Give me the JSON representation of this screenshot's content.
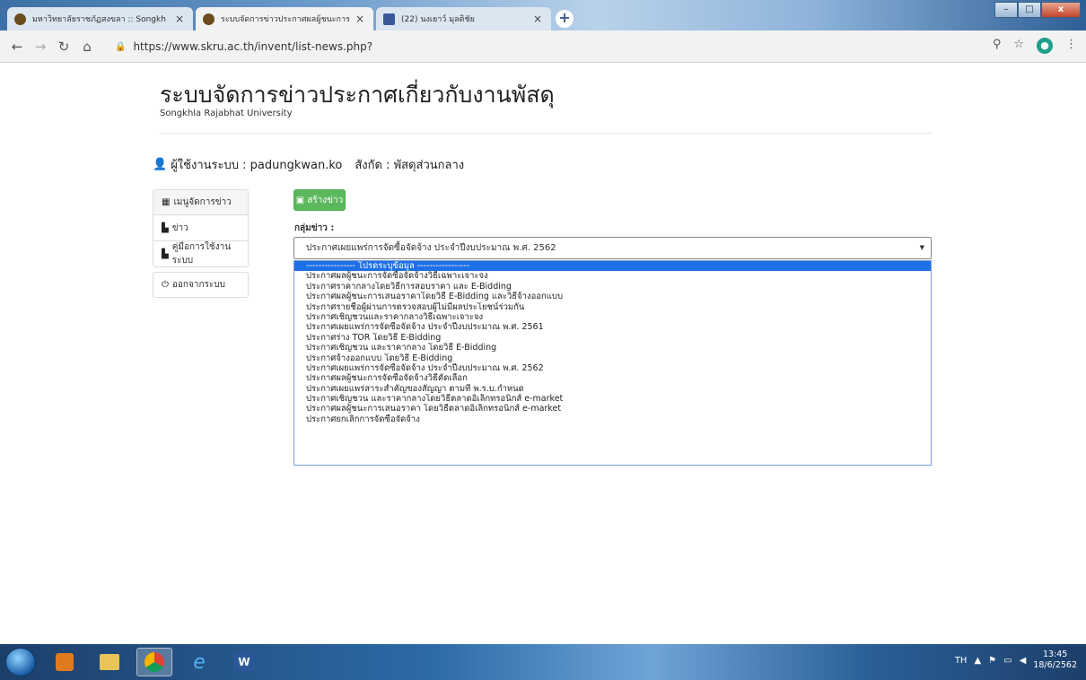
{
  "browser": {
    "tabs": [
      {
        "title": "มหาวิทยาลัยราชภัฏสงขลา :: Songkh",
        "active": false
      },
      {
        "title": "ระบบจัดการข่าวประกาศผลผู้ชนะการจั",
        "active": true
      },
      {
        "title": "(22) นงเยาว์ มุลติชัย",
        "active": false
      }
    ],
    "new_tab": "+",
    "url": "https://www.skru.ac.th/invent/list-news.php?",
    "window_buttons": {
      "minimize": "–",
      "maximize": "□",
      "close": "x"
    }
  },
  "page": {
    "title": "ระบบจัดการข่าวประกาศเกี่ยวกับงานพัสดุ",
    "subtitle": "Songkhla Rajabhat University",
    "user_label": "ผู้ใช้งานระบบ : padungkwan.ko",
    "dept_label": "สังกัด : พัสดุส่วนกลาง"
  },
  "sidebar": {
    "items": [
      {
        "label": "เมนูจัดการข่าว",
        "icon": "grid-icon"
      },
      {
        "label": "ข่าว",
        "icon": "file-icon"
      },
      {
        "label": "คู่มือการใช้งานระบบ",
        "icon": "file-icon"
      },
      {
        "label": "ออกจากระบบ",
        "icon": "power-icon"
      }
    ]
  },
  "form": {
    "create_label": "สร้างข่าว",
    "group_label": "กลุ่มข่าว :",
    "selected_value": "ประกาศเผยแพร่การจัดซื้อจัดจ้าง ประจำปีงบประมาณ พ.ศ. 2562",
    "options": [
      "---------------- โปรดระบุข้อมูล -----------------",
      "ประกาศผลผู้ชนะการจัดซื้อจัดจ้างวิธีเฉพาะเจาะจง",
      "ประกาศราคากลางโดยวิธีการสอบราคา และ E-Bidding",
      "ประกาศผลผู้ชนะการเสนอราคาโดยวิธี E-Bidding และวิธีจ้างออกแบบ",
      "ประกาศรายชื่อผู้ผ่านการตรวจสอบผู้ไม่มีผลประโยชน์ร่วมกัน",
      "ประกาศเชิญชวนและราคากลางวิธีเฉพาะเจาะจง",
      "ประกาศเผยแพร่การจัดซื้อจัดจ้าง ประจำปีงบประมาณ พ.ศ. 2561",
      "ประกาศร่าง TOR โดยวิธี E-Bidding",
      "ประกาศเชิญชวน และราคากลาง โดยวิธี E-Bidding",
      "ประกาศจ้างออกแบบ โดยวิธี E-Bidding",
      "ประกาศเผยแพร่การจัดซื้อจัดจ้าง ประจำปีงบประมาณ พ.ศ. 2562",
      "ประกาศผลผู้ชนะการจัดซื้อจัดจ้างวิธีคัดเลือก",
      "ประกาศเผยแพร่สาระสำคัญของสัญญา ตามที่ พ.ร.บ.กำหนด",
      "ประกาศเชิญชวน และราคากลางโดยวิธีตลาดอิเล็กทรอนิกส์ e-market",
      "ประกาศผลผู้ชนะการเสนอราคา โดยวิธีตลาดอิเล็กทรอนิกส์ e-market",
      "ประกาศยกเลิกการจัดซื้อจัดจ้าง"
    ]
  },
  "taskbar": {
    "language": "TH",
    "time": "13:45",
    "date": "18/6/2562"
  },
  "colors": {
    "primary_button": "#5cb85c",
    "option_highlight": "#1e70e6"
  }
}
